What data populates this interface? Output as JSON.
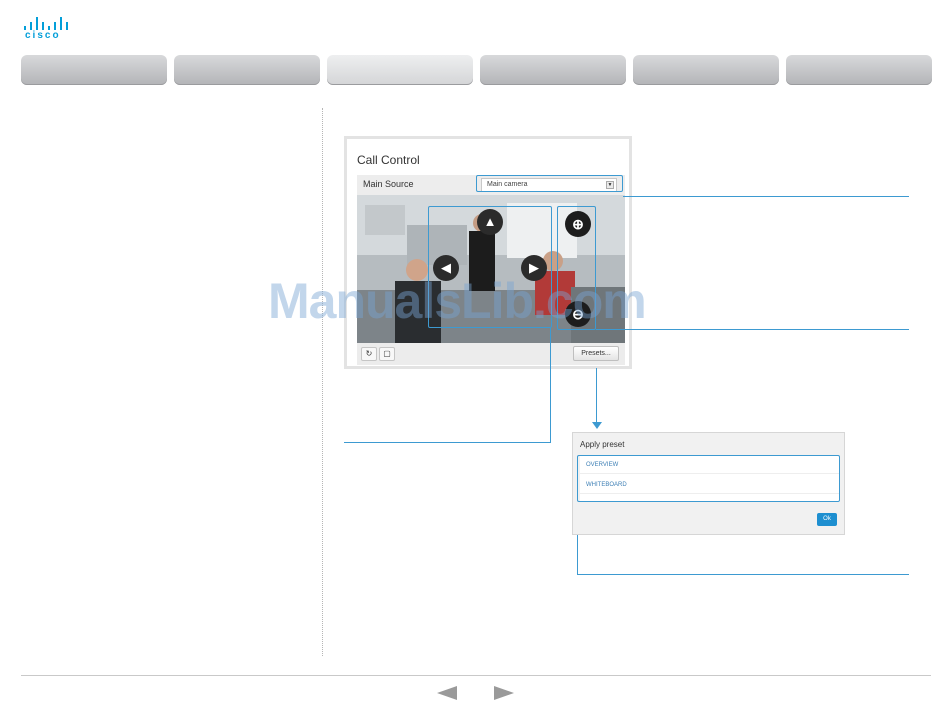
{
  "brand": {
    "name": "cisco",
    "color": "#049fd9"
  },
  "tabs": [
    {
      "label": "",
      "active": false
    },
    {
      "label": "",
      "active": false
    },
    {
      "label": "",
      "active": true
    },
    {
      "label": "",
      "active": false
    },
    {
      "label": "",
      "active": false
    },
    {
      "label": "",
      "active": false
    }
  ],
  "call_control": {
    "title": "Call Control",
    "source_label": "Main Source",
    "source_value": "Main camera",
    "camera_controls": {
      "up_icon": "arrow-up-icon",
      "left_icon": "arrow-left-icon",
      "right_icon": "arrow-right-icon",
      "zoom_in_icon": "zoom-in-icon",
      "zoom_out_icon": "zoom-out-icon"
    },
    "footer": {
      "refresh_icon": "refresh-icon",
      "fullscreen_icon": "square-icon",
      "presets_label": "Presets..."
    }
  },
  "apply_preset": {
    "title": "Apply preset",
    "items": [
      "OVERVIEW",
      "WHITEBOARD"
    ],
    "ok_label": "Ok"
  },
  "watermark": "ManualsLib.com",
  "colors": {
    "accent": "#3d9ad1",
    "ok_button": "#1e8fd0"
  },
  "nav": {
    "prev_icon": "prev-arrow-icon",
    "next_icon": "next-arrow-icon"
  }
}
